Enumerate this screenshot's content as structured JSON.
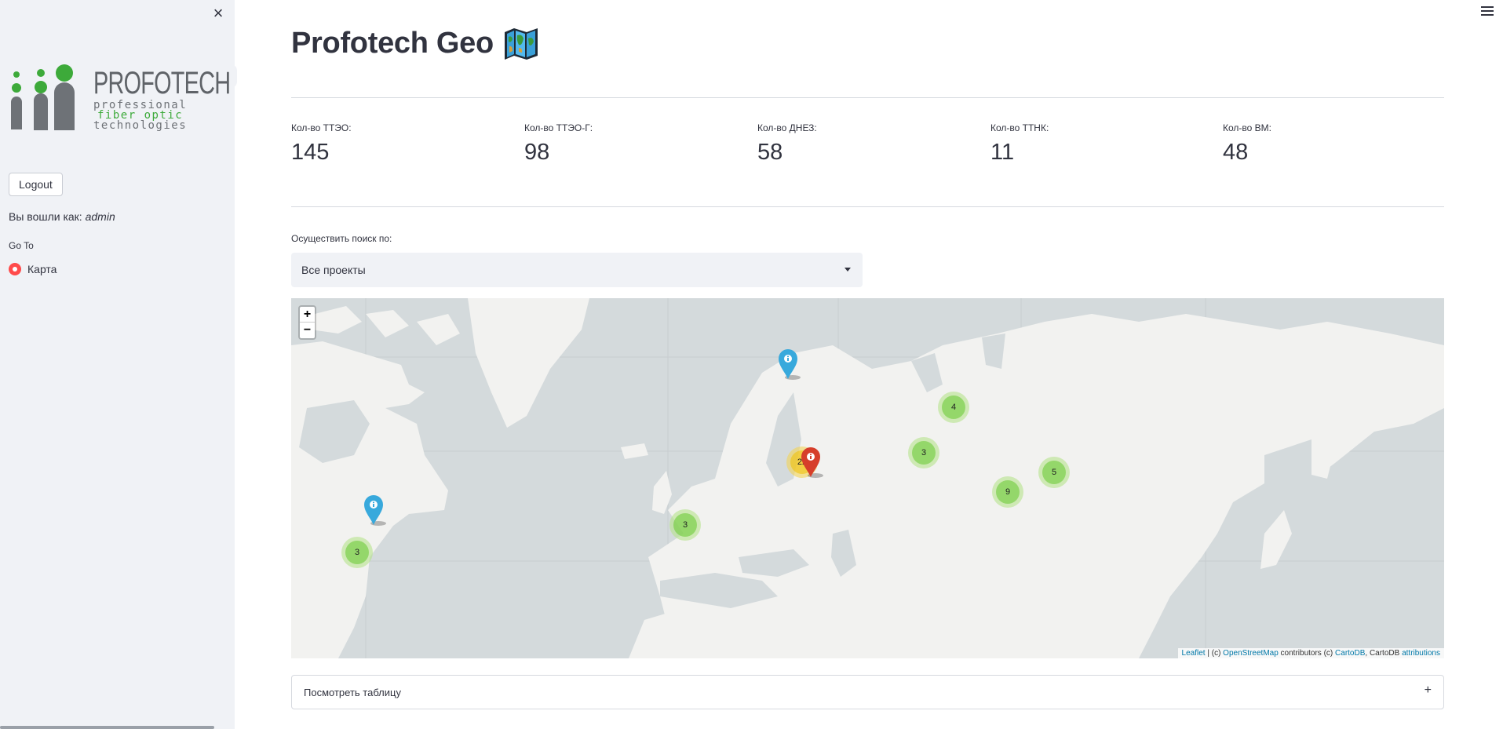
{
  "sidebar": {
    "close_glyph": "×",
    "logo": {
      "brand": "PROFOTECH",
      "line1": "professional",
      "line2": "fiber optic",
      "line3": "technologies"
    },
    "logout_label": "Logout",
    "logged_in_prefix": "Вы вошли как:",
    "logged_in_user": "admin",
    "goto_label": "Go To",
    "nav_option": "Карта"
  },
  "header": {
    "title": "Profotech Geo",
    "title_icon": "world-map-icon"
  },
  "metrics": [
    {
      "label": "Кол-во ТТЭО:",
      "value": "145"
    },
    {
      "label": "Кол-во ТТЭО-Г:",
      "value": "98"
    },
    {
      "label": "Кол-во ДНЕЗ:",
      "value": "58"
    },
    {
      "label": "Кол-во ТТНК:",
      "value": "11"
    },
    {
      "label": "Кол-во ВМ:",
      "value": "48"
    }
  ],
  "search": {
    "label": "Осуществить поиск по:",
    "selected": "Все проекты"
  },
  "map": {
    "zoom_in": "+",
    "zoom_out": "−",
    "clusters": [
      {
        "count": "4"
      },
      {
        "count": "3"
      },
      {
        "count": "22"
      },
      {
        "count": "9"
      },
      {
        "count": "5"
      },
      {
        "count": "3"
      },
      {
        "count": "3"
      }
    ],
    "markers": [
      {
        "color": "#38a9dc",
        "icon": "info-icon"
      },
      {
        "color": "#d63e2a",
        "icon": "info-icon"
      },
      {
        "color": "#38a9dc",
        "icon": "info-icon"
      }
    ],
    "attribution": {
      "leaflet": "Leaflet",
      "sep1": " | (c) ",
      "osm": "OpenStreetMap",
      "mid": " contributors (c) ",
      "cartodb": "CartoDB",
      "sep2": ", CartoDB ",
      "attributions": "attributions"
    }
  },
  "table_expander": {
    "label": "Посмотреть таблицу",
    "toggle": "+"
  },
  "colors": {
    "sidebar_bg": "#f0f2f6",
    "accent": "#ff4b4b",
    "logo_green": "#3daa3a",
    "logo_gray": "#6e7277"
  }
}
